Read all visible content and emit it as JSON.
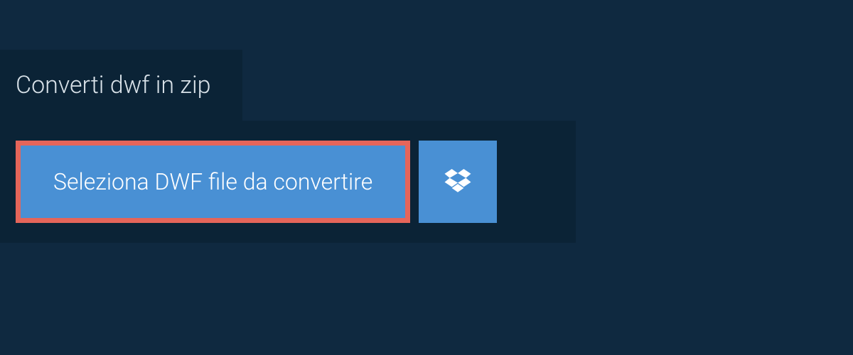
{
  "tab": {
    "title": "Converti dwf in zip"
  },
  "upload": {
    "select_button_label": "Seleziona DWF file da convertire"
  },
  "colors": {
    "background": "#0f2940",
    "panel": "#0b2336",
    "button_primary": "#4990d4",
    "highlight_border": "#e5655a",
    "text_light": "#d8e1e8",
    "text_white": "#ffffff"
  }
}
